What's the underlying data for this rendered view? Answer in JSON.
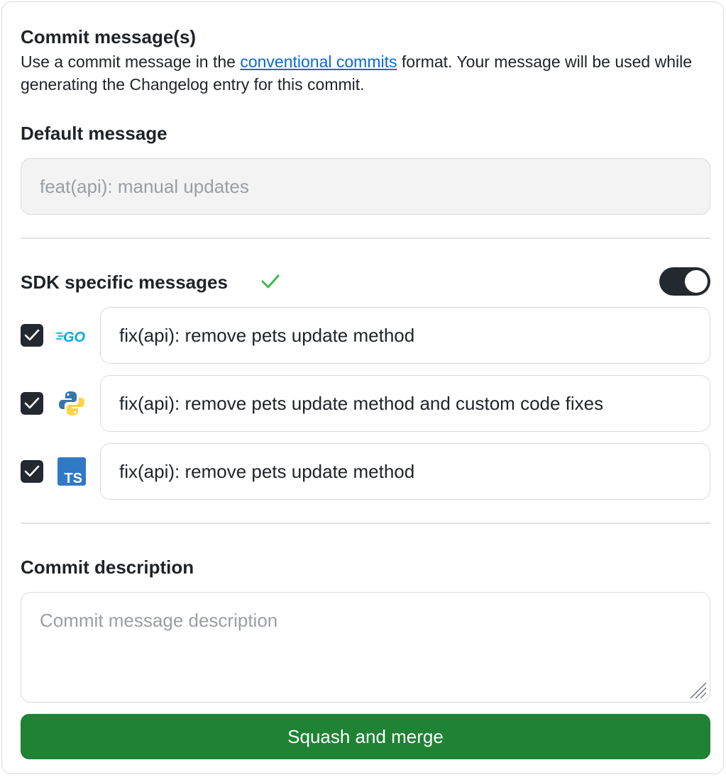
{
  "commit_messages": {
    "title": "Commit message(s)",
    "intro_before": "Use a commit message in the ",
    "intro_link": "conventional commits",
    "intro_after": " format. Your message will be used while generating the Changelog entry for this commit."
  },
  "default_message": {
    "title": "Default message",
    "value": "feat(api): manual updates"
  },
  "sdk_messages": {
    "title": "SDK specific messages",
    "status_icon": "check-icon",
    "toggle_on": true,
    "accent_color": "#3fb950",
    "go_label": "GO",
    "ts_label": "TS",
    "items": [
      {
        "language": "go",
        "icon": "go-logo-icon",
        "checked": true,
        "value": "fix(api): remove pets update method"
      },
      {
        "language": "python",
        "icon": "python-logo-icon",
        "checked": true,
        "value": "fix(api): remove pets update method and custom code fixes"
      },
      {
        "language": "typescript",
        "icon": "typescript-logo-icon",
        "checked": true,
        "value": "fix(api): remove pets update method"
      }
    ]
  },
  "commit_description": {
    "title": "Commit description",
    "placeholder": "Commit message description",
    "value": ""
  },
  "actions": {
    "submit_label": "Squash and merge",
    "submit_color": "#1f8234"
  }
}
